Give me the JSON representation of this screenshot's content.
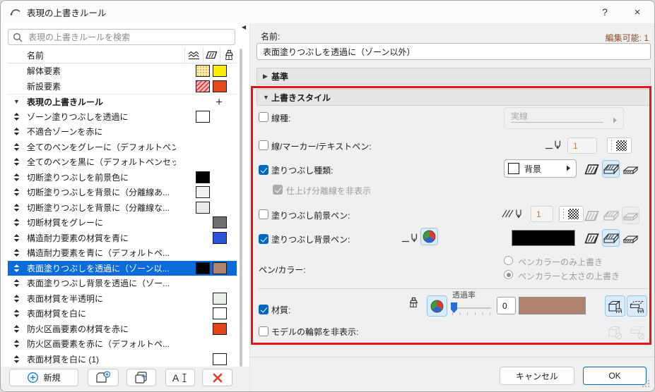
{
  "window": {
    "title": "表現の上書きルール",
    "help_label": "?",
    "close_label": "×"
  },
  "search": {
    "placeholder": "表現の上書きルールを検索"
  },
  "list": {
    "header": {
      "name_col": "名前"
    },
    "top_rows": [
      {
        "label": "解体要素",
        "fill": "dot-yellow",
        "pen": "#fcee0a"
      },
      {
        "label": "新設要素",
        "fill": "hatch-red",
        "pen": "#e5491c"
      }
    ],
    "group": {
      "label": "表現の上書きルール",
      "add_label": "+"
    },
    "rows": [
      {
        "label": "ゾーン塗りつぶしを透過に",
        "fill": "#ffffff"
      },
      {
        "label": "不適合ゾーンを赤に"
      },
      {
        "label": "全てのペンをグレーに（デフォルトペン..."
      },
      {
        "label": "全てのペンを黒に（デフォルトペンセッ..."
      },
      {
        "label": "切断塗りつぶしを前景色に",
        "fill": "#000000"
      },
      {
        "label": "切断塗りつぶしを背景に（分離線あ...",
        "fill": "#f3f3f3"
      },
      {
        "label": "切断塗りつぶしを背景に（分離線な...",
        "fill": "#ebebeb"
      },
      {
        "label": "切断材質をグレーに",
        "pen": "#6e6e6e"
      },
      {
        "label": "構造耐力要素の材質を青に",
        "pen": "#2b52dc"
      },
      {
        "label": "構造耐力要素を青に（デフォルトペ..."
      },
      {
        "label": "表面塗りつぶしを透過に（ゾーン以...",
        "fill": "#000000",
        "pen": "#b1836f",
        "selected": true
      },
      {
        "label": "表面塗りつぶし背景を透過に（ゾー..."
      },
      {
        "label": "表面材質を半透明に",
        "pen": "#e8efe7"
      },
      {
        "label": "表面材質を白に",
        "pen": "#ffffff"
      },
      {
        "label": "防火区画要素の材質を赤に",
        "pen": "#e04617"
      },
      {
        "label": "防火区画要素を赤に（デフォルトペ..."
      },
      {
        "label": "表面材質を白に (1)",
        "pen": "#ffffff"
      }
    ]
  },
  "left_buttons": {
    "new_label": "新規"
  },
  "detail": {
    "name_label": "名前:",
    "editable_label": "編集可能: 1",
    "name_value": "表面塗りつぶしを透過に（ゾーン以外）",
    "sections": {
      "criteria": "基準",
      "override_style": "上書きスタイル"
    },
    "rows": {
      "line_type": {
        "label": "線種:",
        "value": "実線"
      },
      "pen": {
        "label": "線/マーカー/テキストペン:",
        "value": "1"
      },
      "fill_type": {
        "label": "塗りつぶし種類:",
        "value": "背景"
      },
      "hide_finish_lines": {
        "label": "仕上げ分離線を非表示"
      },
      "fill_fg_pen": {
        "label": "塗りつぶし前景ペン:",
        "value": "1"
      },
      "fill_bg_pen": {
        "label": "塗りつぶし背景ペン:",
        "color": "#000000"
      },
      "pen_color": {
        "label": "ペン/カラー:",
        "options": [
          "ペンカラーのみ上書き",
          "ペンカラーと太さの上書き"
        ],
        "selected": "ペンカラーと太さの上書き"
      },
      "surface": {
        "label": "材質:",
        "transparency_label": "透過率",
        "transparency_value": "0",
        "color": "#b1836f"
      },
      "hide_outline": {
        "label": "モデルの輪郭を非表示:"
      }
    }
  },
  "footer": {
    "cancel": "キャンセル",
    "ok": "OK"
  },
  "colors": {
    "selection": "#0d6bd9",
    "annotation": "#e81313",
    "checkbox_accent": "#0067c0",
    "toggle_active_bg": "#d9ecfb"
  }
}
